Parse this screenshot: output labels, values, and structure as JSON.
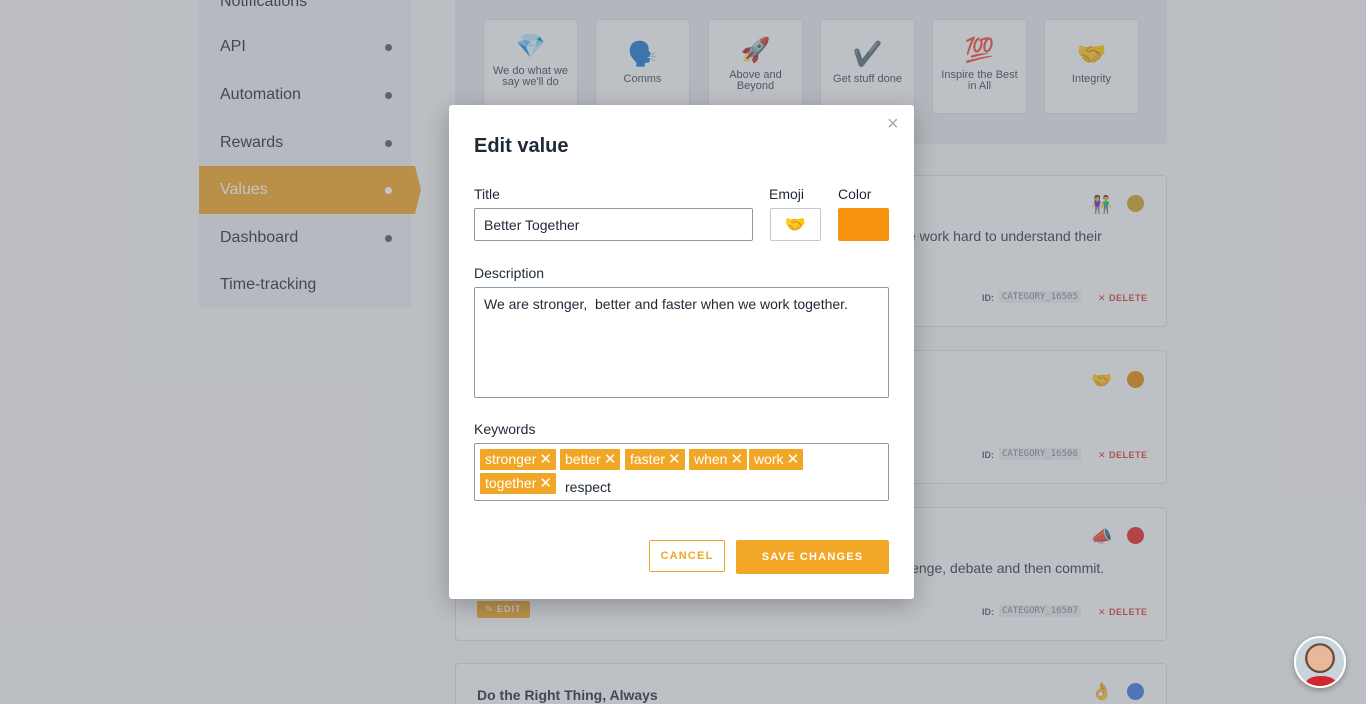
{
  "sidebar": {
    "items": [
      {
        "label": "Notifications"
      },
      {
        "label": "API"
      },
      {
        "label": "Automation"
      },
      {
        "label": "Rewards"
      },
      {
        "label": "Values",
        "active": true
      },
      {
        "label": "Dashboard"
      },
      {
        "label": "Time-tracking"
      }
    ]
  },
  "value_tiles": [
    {
      "emoji": "💎",
      "label": "We do what we say we'll do"
    },
    {
      "emoji": "🗣️",
      "label": "Comms"
    },
    {
      "emoji": "🚀",
      "label": "Above and Beyond"
    },
    {
      "emoji": "✔️",
      "label": "Get stuff done"
    },
    {
      "emoji": "💯",
      "label": "Inspire the Best in All"
    },
    {
      "emoji": "🤝",
      "label": "Integrity"
    }
  ],
  "cards": [
    {
      "text": "e work hard to understand their",
      "emoji": "👫",
      "color": "#c9a227",
      "id_label": "ID:",
      "id": "CATEGORY_16505",
      "delete": "✕ DELETE"
    },
    {
      "text": "",
      "emoji": "🤝",
      "color": "#e08a0c",
      "id_label": "ID:",
      "id": "CATEGORY_16506",
      "delete": "✕ DELETE"
    },
    {
      "text": "lenge, debate and then commit.",
      "emoji": "📣",
      "color": "#e02424",
      "id_label": "ID:",
      "id": "CATEGORY_16507",
      "delete": "✕ DELETE",
      "edit": "✎ EDIT"
    },
    {
      "title": "Do the Right Thing, Always",
      "emoji": "👌",
      "color": "#3b76e0"
    }
  ],
  "modal": {
    "heading": "Edit value",
    "close": "×",
    "title_label": "Title",
    "title_value": "Better Together",
    "emoji_label": "Emoji",
    "emoji_value": "🤝",
    "color_label": "Color",
    "color_value": "#f5940c",
    "description_label": "Description",
    "description_value": "We are stronger,  better and faster when we work together.",
    "keywords_label": "Keywords",
    "keywords": [
      "stronger",
      "better",
      "faster",
      "when",
      "work",
      "together"
    ],
    "keyword_input": "respect",
    "cancel_label": "CANCEL",
    "save_label": "SAVE CHANGES"
  },
  "colors": {
    "accent": "#f2a626"
  }
}
